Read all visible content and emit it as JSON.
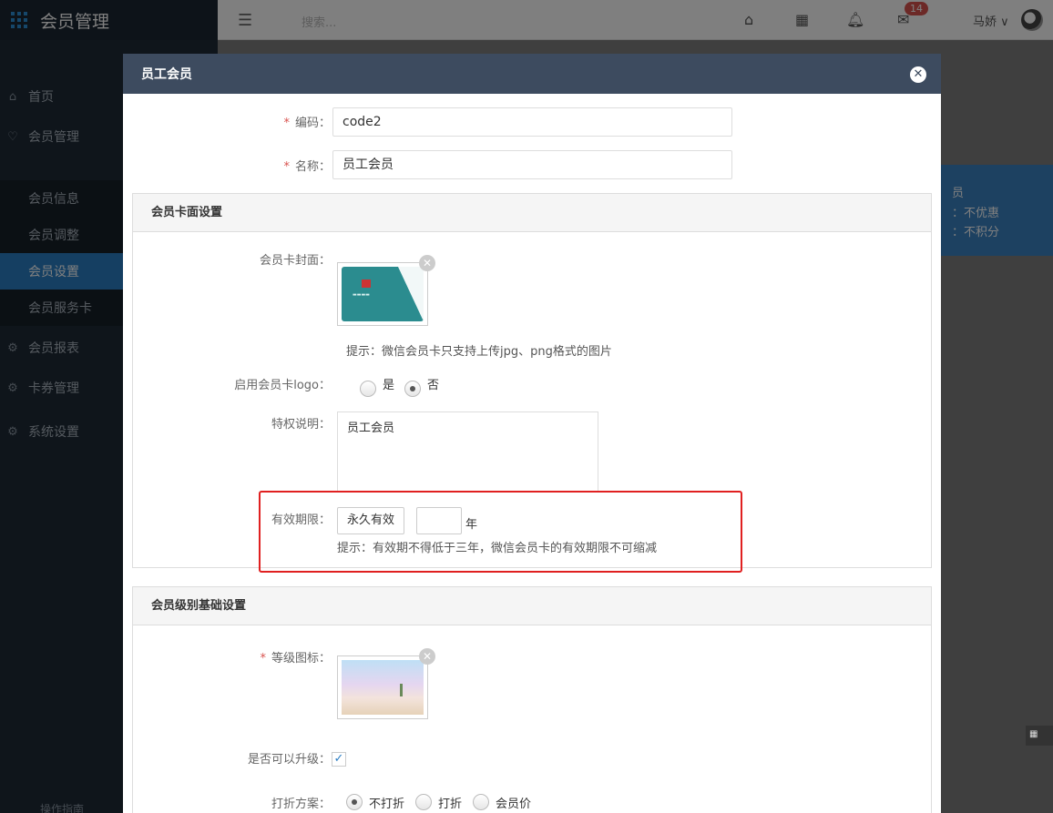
{
  "app": {
    "title": "会员管理"
  },
  "topbar": {
    "search_placeholder": "搜索...",
    "mail_badge": "14",
    "user_name": "马娇"
  },
  "sidebar": {
    "items": [
      {
        "label": "首页",
        "icon": "home-icon"
      },
      {
        "label": "会员管理",
        "icon": "heart-icon"
      },
      {
        "label": "会员报表",
        "icon": "gear-icon"
      },
      {
        "label": "卡券管理",
        "icon": "gear-icon"
      },
      {
        "label": "系统设置",
        "icon": "gear-icon"
      }
    ],
    "sub_items": [
      {
        "label": "会员信息"
      },
      {
        "label": "会员调整"
      },
      {
        "label": "会员设置",
        "active": true
      },
      {
        "label": "会员服务卡"
      }
    ],
    "help_label": "操作指南"
  },
  "background": {
    "panel_title": "员",
    "panel_line1": "：不优惠",
    "panel_line2": "：不积分"
  },
  "modal": {
    "title": "员工会员",
    "code_label": "编码：",
    "code_value": "code2",
    "name_label": "名称：",
    "name_value": "员工会员",
    "card_section": {
      "title": "会员卡面设置",
      "cover_label": "会员卡封面：",
      "cover_hint": "提示：微信会员卡只支持上传jpg、png格式的图片",
      "logo_label": "启用会员卡logo：",
      "logo_yes": "是",
      "logo_no": "否",
      "logo_selected": "否",
      "privilege_label": "特权说明：",
      "privilege_value": "员工会员",
      "validity_label": "有效期限：",
      "validity_option": "永久有效",
      "validity_unit": "年",
      "validity_hint": "提示：有效期不得低于三年，微信会员卡的有效期限不可缩减"
    },
    "level_section": {
      "title": "会员级别基础设置",
      "icon_label": "等级图标：",
      "upgrade_label": "是否可以升级：",
      "upgrade_checked": true,
      "discount_label": "打折方案：",
      "discount_options": [
        "不打折",
        "打折",
        "会员价"
      ],
      "discount_selected": "不打折"
    }
  },
  "colors": {
    "sidebar_bg": "#1e2a36",
    "accent": "#2b7ec4",
    "modal_header": "#3d4b5f",
    "highlight": "#e02020",
    "required": "#d9534f"
  }
}
